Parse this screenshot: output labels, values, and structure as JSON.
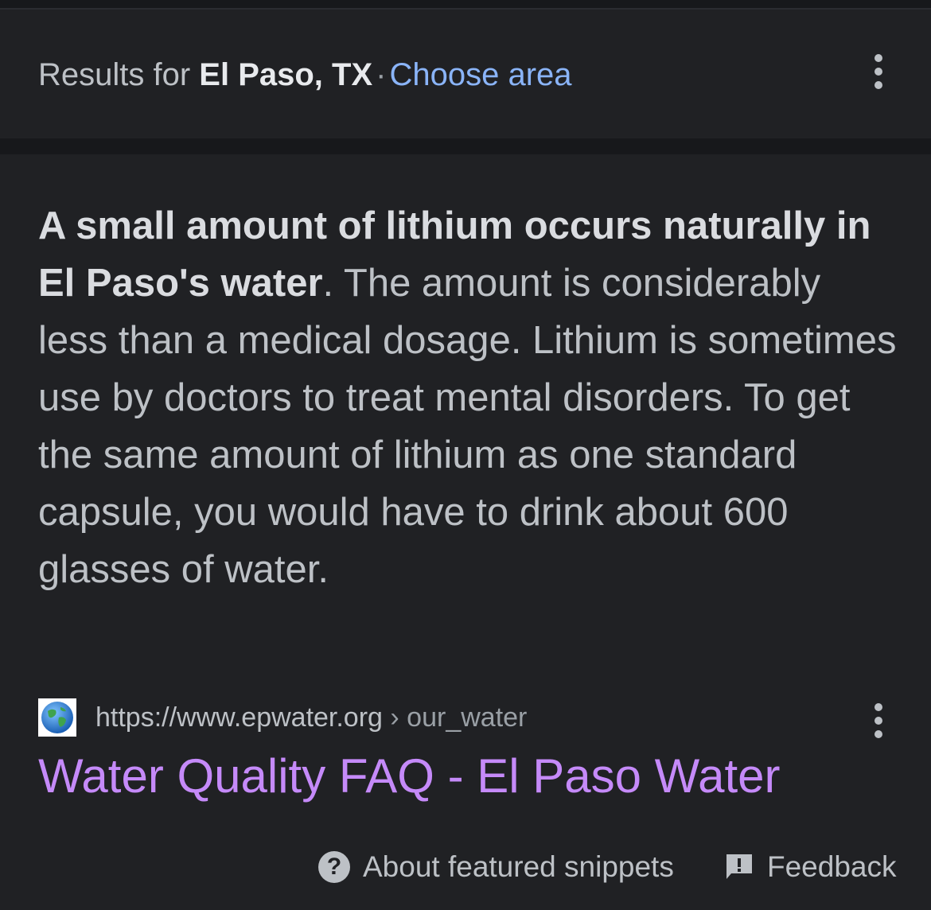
{
  "location": {
    "prefix": "Results for",
    "place": "El Paso, TX",
    "separator": "·",
    "choose_area": "Choose area"
  },
  "snippet": {
    "bold_text": "A small amount of lithium occurs naturally in El Paso's water",
    "body_text": ". The amount is considerably less than a medical dosage. Lithium is sometimes use by doctors to treat mental disorders. To get the same amount of lithium as one standard capsule, you would have to drink about 600 glasses of water."
  },
  "source": {
    "favicon": "globe-icon",
    "url": "https://www.epwater.org",
    "breadcrumb": "› our_water",
    "title": "Water Quality FAQ - El Paso Water"
  },
  "footer": {
    "about": "About featured snippets",
    "feedback": "Feedback"
  },
  "colors": {
    "background": "#202124",
    "link_blue": "#8ab4f8",
    "visited_purple": "#c58af9",
    "text": "#bdc1c6"
  }
}
